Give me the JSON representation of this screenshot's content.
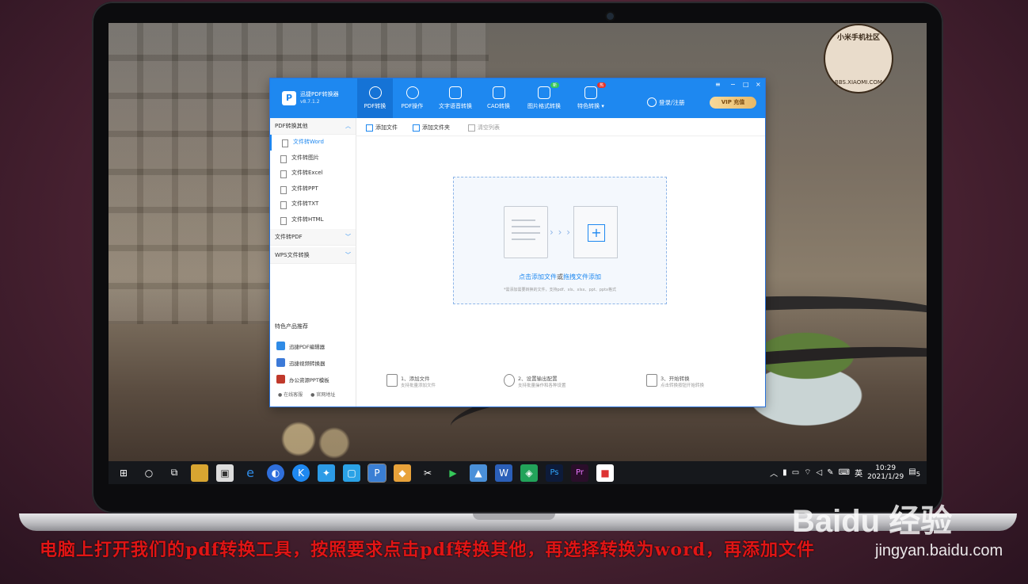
{
  "app": {
    "name": "迅捷PDF转换器",
    "version": "v8.7.1.2",
    "tabs": [
      {
        "label": "PDF转换"
      },
      {
        "label": "PDF操作"
      },
      {
        "label": "文字语音转换"
      },
      {
        "label": "CAD转换"
      },
      {
        "label": "图片格式转换"
      },
      {
        "label": "特色转换 ▾"
      }
    ],
    "badge_new": "新",
    "badge_hot": "热",
    "login": "登录/注册",
    "vip": "VIP 充值",
    "win_min": "−",
    "win_restore": "≡",
    "win_max": "□",
    "win_close": "×"
  },
  "sidebar": {
    "group1": "PDF转换其他",
    "items": [
      {
        "label": "文件转Word"
      },
      {
        "label": "文件转图片"
      },
      {
        "label": "文件转Excel"
      },
      {
        "label": "文件转PPT"
      },
      {
        "label": "文件转TXT"
      },
      {
        "label": "文件转HTML"
      }
    ],
    "group2": "文件转PDF",
    "group3": "WPS文件转换",
    "rec_title": "特色产品推荐",
    "recs": [
      {
        "label": "迅捷PDF编辑器"
      },
      {
        "label": "迅捷视频转换器"
      },
      {
        "label": "办公资源PPT模板"
      }
    ],
    "link_support": "在线客服",
    "link_site": "官网地址"
  },
  "toolbar": {
    "add_file": "添加文件",
    "add_folder": "添加文件夹",
    "clear": "清空列表"
  },
  "drop": {
    "link1": "点击添加文件",
    "or": "或",
    "link2": "拖拽文件添加",
    "hint": "*需添加需要转换的文件，支持pdf、xls、xlsx、ppt、pptx格式"
  },
  "steps": [
    {
      "title": "1、添加文件",
      "sub": "支持批量添加文件"
    },
    {
      "title": "2、设置输出配置",
      "sub": "支持批量操作和各种设置"
    },
    {
      "title": "3、开始转换",
      "sub": "点击转换按钮开始转换"
    }
  ],
  "taskbar": {
    "time": "10:29",
    "date": "2021/1/29",
    "ime": "英",
    "notif": "5"
  },
  "watermark": {
    "line1": "小米手机社区",
    "line2": "BBS.XIAOMI.COM"
  },
  "baidu": "Baidu 经验",
  "jingyan": "jingyan.baidu.com",
  "caption": "电脑上打开我们的pdf转换工具，按照要求点击pdf转换其他，再选择转换为word，再添加文件"
}
